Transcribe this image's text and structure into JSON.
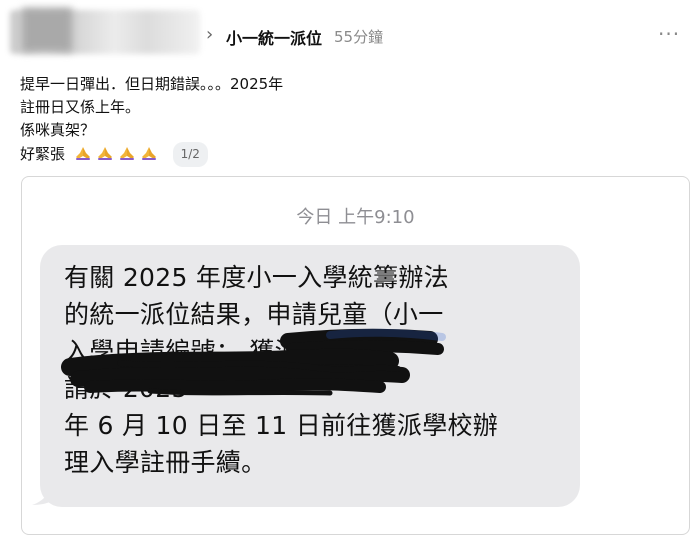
{
  "header": {
    "group_name": "小一統一派位",
    "time_ago": "55分鐘",
    "chevron": "›",
    "more": "···"
  },
  "post": {
    "line1": "提早一日彈出．但日期錯誤。。。2025年",
    "line2": "註冊日又係上年。",
    "line3": "係咪真架？",
    "line4": "好緊張",
    "reaction_icon": "folded-hands",
    "reaction_count": 4,
    "image_counter": "1/2"
  },
  "screenshot": {
    "timestamp": "今日 上午9:10",
    "message_lines": [
      "有關 2025 年度小一入學統籌辦法",
      "的統一派位結果，申請兒童（小一",
      "入學申請編號：                    獲派",
      "                                            請於 2025",
      "年 6 月 10 日至 11 日前往獲派學校辦",
      "理入學註冊手續。"
    ],
    "bubble_color": "#e9e9eb",
    "redaction_color": "#111111"
  }
}
